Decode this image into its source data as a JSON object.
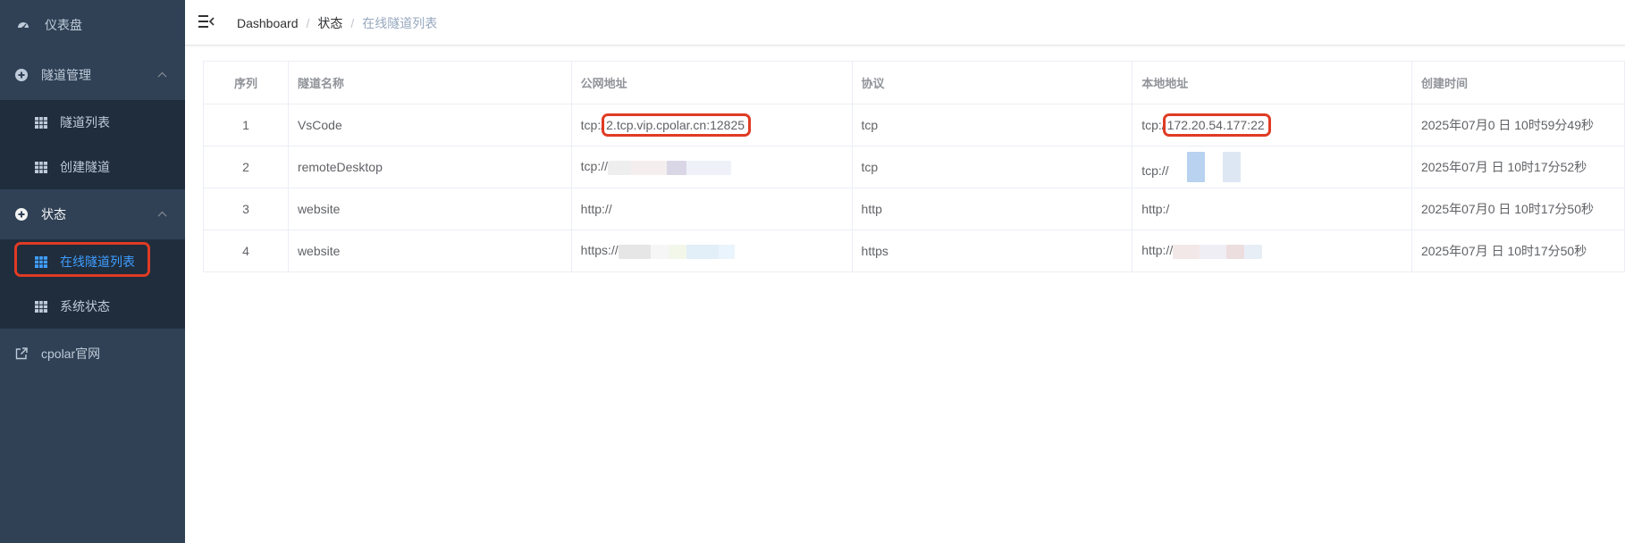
{
  "sidebar": {
    "dashboard": "仪表盘",
    "tunnel_mgmt": "隧道管理",
    "tunnel_list": "隧道列表",
    "create_tunnel": "创建隧道",
    "status": "状态",
    "online_tunnels": "在线隧道列表",
    "system_status": "系统状态",
    "website": "cpolar官网"
  },
  "breadcrumb": {
    "item1": "Dashboard",
    "item2": "状态",
    "current": "在线隧道列表"
  },
  "table": {
    "headers": [
      "序列",
      "隧道名称",
      "公网地址",
      "协议",
      "本地地址",
      "创建时间"
    ],
    "rows": [
      {
        "id": "1",
        "name": "VsCode",
        "public_prefix": "tcp:/",
        "public_main": "2.tcp.vip.cpolar.cn:12825",
        "protocol": "tcp",
        "local_prefix": "tcp:/",
        "local_main": "172.20.54.177:22",
        "created": "2025年07月0  日 10时59分49秒"
      },
      {
        "id": "2",
        "name": "remoteDesktop",
        "public_prefix": "tcp://",
        "public_main": "",
        "protocol": "tcp",
        "local_prefix": "tcp://",
        "local_main": "",
        "created": "2025年07月  日 10时17分52秒"
      },
      {
        "id": "3",
        "name": "website",
        "public_prefix": "http://",
        "public_main": "",
        "protocol": "http",
        "local_prefix": "http:/",
        "local_main": "",
        "created": "2025年07月0  日 10时17分50秒"
      },
      {
        "id": "4",
        "name": "website",
        "public_prefix": "https://",
        "public_main": "",
        "protocol": "https",
        "local_prefix": "http://",
        "local_main": "",
        "created": "2025年07月  日 10时17分50秒"
      }
    ]
  },
  "colors": {
    "sidebar_bg": "#304156",
    "submenu_bg": "#1f2d3d",
    "active": "#409eff",
    "highlight_box": "#e03b24"
  }
}
